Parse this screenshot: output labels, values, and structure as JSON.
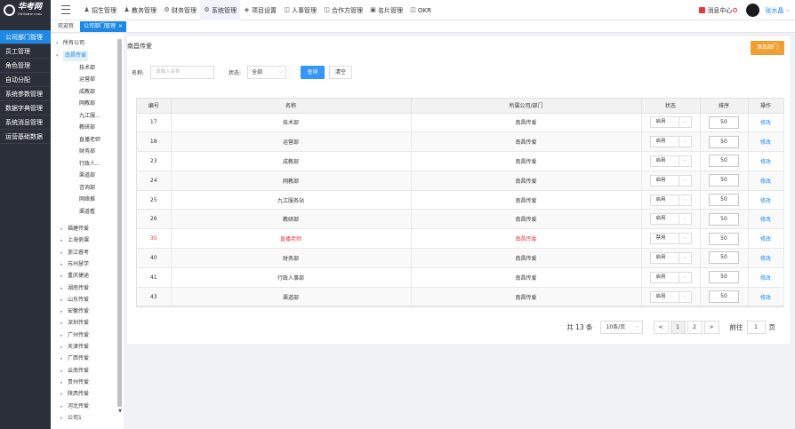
{
  "brand": {
    "name": "华考网",
    "domain": "360xkw.com"
  },
  "nav": [
    {
      "label": "招生管理",
      "icon": "person-icon"
    },
    {
      "label": "教务管理",
      "icon": "person-icon"
    },
    {
      "label": "财务管理",
      "icon": "gear-icon"
    },
    {
      "label": "系统管理",
      "icon": "gear-icon",
      "active": true
    },
    {
      "label": "项目设置",
      "icon": "layers-icon"
    },
    {
      "label": "人事管理",
      "icon": "chat-icon"
    },
    {
      "label": "合作方管理",
      "icon": "chat-icon"
    },
    {
      "label": "名片管理",
      "icon": "card-icon"
    },
    {
      "label": "OKR",
      "icon": "chat-icon"
    }
  ],
  "header": {
    "messages": "消息中心",
    "user": "张水晶"
  },
  "sidebar": [
    "公司部门管理",
    "员工管理",
    "角色管理",
    "自动分配",
    "系统参数管理",
    "数据字典管理",
    "系统消息管理",
    "运营基础数据"
  ],
  "tabs": [
    {
      "label": "欢迎页"
    },
    {
      "label": "公司部门管理",
      "active": true,
      "close": "×"
    }
  ],
  "tree": {
    "root": "所有公司",
    "selected": "南昌传爱",
    "children": [
      "技术部",
      "运营部",
      "成教部",
      "网教部",
      "九江服...",
      "教研部",
      "直播老师",
      "财务部",
      "行政人...",
      "渠道部",
      "咨询部",
      "网络推",
      "渠道看"
    ],
    "others": [
      "福建传爱",
      "上海俏课",
      "浙江睿考",
      "苏州慧学",
      "重庆捷途",
      "湖南传爱",
      "山东传爱",
      "安徽传爱",
      "深圳传爱",
      "广州传爱",
      "天津传爱",
      "广西传爱",
      "云南传爱",
      "贵州传爱",
      "陕西传爱",
      "河北传爱",
      "公司1"
    ]
  },
  "content": {
    "breadcrumb": "南昌传爱",
    "add_button": "添加部门",
    "filter": {
      "name_label": "名称:",
      "name_placeholder": "请输入名称",
      "status_label": "状态:",
      "status_value": "全部",
      "query": "查询",
      "reset": "清空"
    }
  },
  "table": {
    "headers": [
      "编号",
      "名称",
      "所属公司/部门",
      "状态",
      "排序",
      "操作"
    ],
    "rows": [
      {
        "id": "17",
        "name": "技术部",
        "dept": "南昌传爱",
        "status": "启用",
        "order": "50",
        "op": "修改"
      },
      {
        "id": "18",
        "name": "运营部",
        "dept": "南昌传爱",
        "status": "启用",
        "order": "50",
        "op": "修改"
      },
      {
        "id": "23",
        "name": "成教部",
        "dept": "南昌传爱",
        "status": "启用",
        "order": "50",
        "op": "修改"
      },
      {
        "id": "24",
        "name": "网教部",
        "dept": "南昌传爱",
        "status": "启用",
        "order": "50",
        "op": "修改"
      },
      {
        "id": "25",
        "name": "九江服务站",
        "dept": "南昌传爱",
        "status": "启用",
        "order": "50",
        "op": "修改"
      },
      {
        "id": "26",
        "name": "教研部",
        "dept": "南昌传爱",
        "status": "启用",
        "order": "50",
        "op": "修改"
      },
      {
        "id": "35",
        "name": "直播老师",
        "dept": "南昌传爱",
        "status": "禁用",
        "order": "50",
        "op": "修改",
        "disabled": true
      },
      {
        "id": "40",
        "name": "财务部",
        "dept": "南昌传爱",
        "status": "启用",
        "order": "50",
        "op": "修改"
      },
      {
        "id": "41",
        "name": "行政人事部",
        "dept": "南昌传爱",
        "status": "启用",
        "order": "50",
        "op": "修改"
      },
      {
        "id": "43",
        "name": "渠道部",
        "dept": "南昌传爱",
        "status": "启用",
        "order": "50",
        "op": "修改"
      }
    ]
  },
  "pager": {
    "total": "共 13 条",
    "page_size": "10条/页",
    "prev": "<",
    "pages": [
      "1",
      "2"
    ],
    "current": "1",
    "next": ">",
    "goto_label": "前往",
    "goto_value": "1",
    "goto_unit": "页"
  },
  "colors": {
    "accent": "#1e88e5",
    "sidebar": "#2b2f3a",
    "add_button": "#f0a030",
    "danger": "#e0383e"
  }
}
